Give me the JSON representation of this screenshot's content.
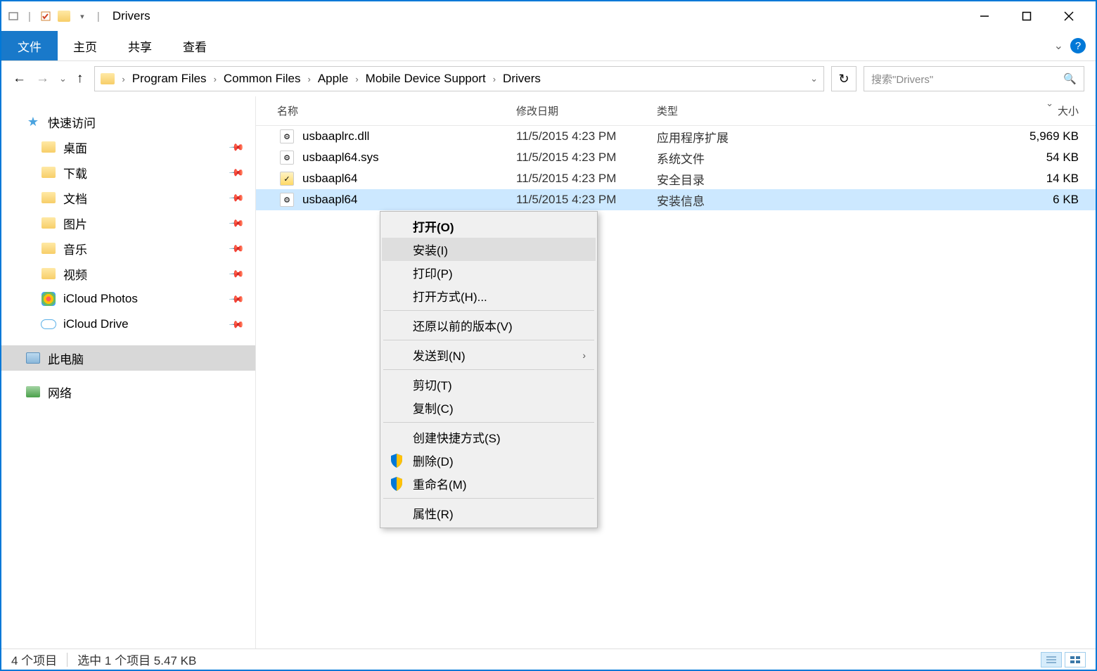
{
  "titlebar": {
    "title": "Drivers"
  },
  "ribbon": {
    "file": "文件",
    "tabs": [
      "主页",
      "共享",
      "查看"
    ]
  },
  "breadcrumb": {
    "items": [
      "Program Files",
      "Common Files",
      "Apple",
      "Mobile Device Support",
      "Drivers"
    ]
  },
  "search": {
    "placeholder": "搜索\"Drivers\""
  },
  "sidebar": {
    "quick_access": "快速访问",
    "desktop": "桌面",
    "downloads": "下载",
    "documents": "文档",
    "pictures": "图片",
    "music": "音乐",
    "videos": "视频",
    "icloud_photos": "iCloud Photos",
    "icloud_drive": "iCloud Drive",
    "this_pc": "此电脑",
    "network": "网络"
  },
  "columns": {
    "name": "名称",
    "date": "修改日期",
    "type": "类型",
    "size": "大小"
  },
  "files": [
    {
      "name": "usbaaplrc.dll",
      "date": "11/5/2015 4:23 PM",
      "type": "应用程序扩展",
      "size": "5,969 KB",
      "icon": "dll"
    },
    {
      "name": "usbaapl64.sys",
      "date": "11/5/2015 4:23 PM",
      "type": "系统文件",
      "size": "54 KB",
      "icon": "sys"
    },
    {
      "name": "usbaapl64",
      "date": "11/5/2015 4:23 PM",
      "type": "安全目录",
      "size": "14 KB",
      "icon": "cat"
    },
    {
      "name": "usbaapl64",
      "date": "11/5/2015 4:23 PM",
      "type": "安装信息",
      "size": "6 KB",
      "icon": "inf",
      "selected": true
    }
  ],
  "context_menu": {
    "open": "打开(O)",
    "install": "安装(I)",
    "print": "打印(P)",
    "open_with": "打开方式(H)...",
    "restore": "还原以前的版本(V)",
    "send_to": "发送到(N)",
    "cut": "剪切(T)",
    "copy": "复制(C)",
    "shortcut": "创建快捷方式(S)",
    "delete": "删除(D)",
    "rename": "重命名(M)",
    "properties": "属性(R)"
  },
  "statusbar": {
    "count": "4 个项目",
    "selection": "选中 1 个项目 5.47 KB"
  }
}
